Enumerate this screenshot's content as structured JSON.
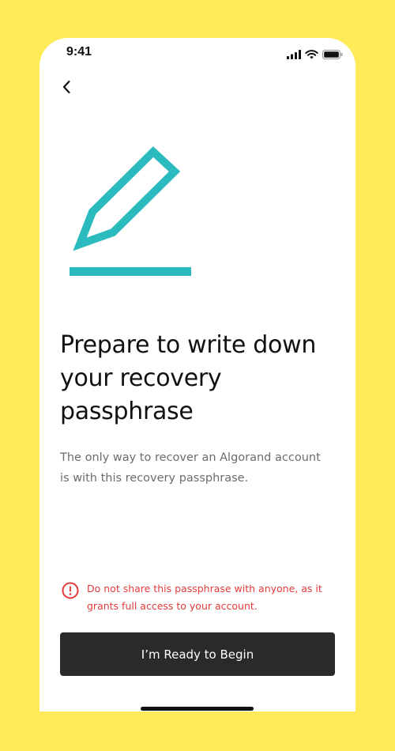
{
  "status_bar": {
    "time": "9:41",
    "signal_icon": "cellular-signal-icon",
    "wifi_icon": "wifi-icon",
    "battery_icon": "battery-icon"
  },
  "nav": {
    "back_icon": "chevron-left-icon"
  },
  "illustration": {
    "icon": "pencil-icon",
    "color": "#2BBBBF"
  },
  "title": "Prepare to write down your recovery passphrase",
  "description": "The only way to recover an Algorand account is with this recovery passphrase.",
  "warning": {
    "icon": "alert-circle-icon",
    "text": "Do not share this passphrase with anyone, as it grants full access to your account.",
    "color": "#E43B3B"
  },
  "cta": {
    "label": "I’m Ready to Begin",
    "background": "#2A2A2C"
  },
  "colors": {
    "page_background": "#FFEB57",
    "screen_background": "#FFFFFF"
  }
}
